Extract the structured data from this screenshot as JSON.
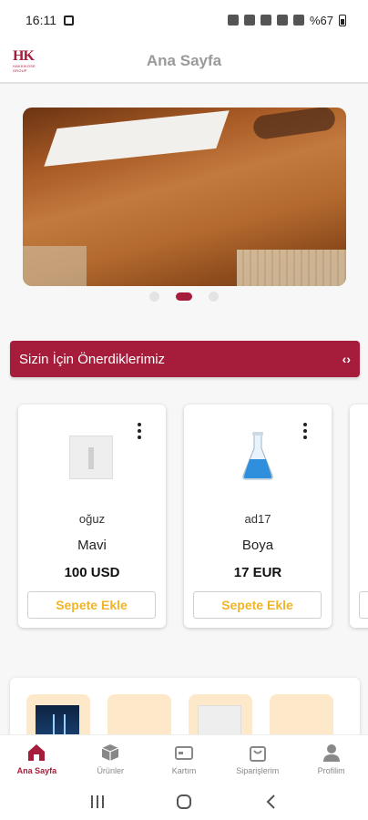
{
  "status_bar": {
    "time": "16:11",
    "battery_text": "%67"
  },
  "header": {
    "title": "Ana Sayfa",
    "logo_text": "HK",
    "logo_sub": "HAKKIKOSE GROUP"
  },
  "carousel": {
    "slide_count": 3,
    "active_index": 1
  },
  "section": {
    "title": "Sizin İçin Önerdiklerimiz",
    "nav_glyph": "‹›"
  },
  "products": [
    {
      "seller": "oğuz",
      "name": "Mavi",
      "price": "100 USD",
      "button": "Sepete Ekle",
      "thumb": "white-box-image"
    },
    {
      "seller": "ad17",
      "name": "Boya",
      "price": "17 EUR",
      "button": "Sepete Ekle",
      "thumb": "blue-flask-icon"
    }
  ],
  "tabbar": {
    "items": [
      {
        "label": "Ana Sayfa",
        "icon": "home-icon",
        "active": true
      },
      {
        "label": "Ürünler",
        "icon": "box-icon",
        "active": false
      },
      {
        "label": "Kartım",
        "icon": "card-icon",
        "active": false
      },
      {
        "label": "Siparişlerim",
        "icon": "bag-icon",
        "active": false
      },
      {
        "label": "Profilim",
        "icon": "user-icon",
        "active": false
      }
    ]
  },
  "colors": {
    "brand": "#a51d3a",
    "button_text": "#f0b429"
  }
}
